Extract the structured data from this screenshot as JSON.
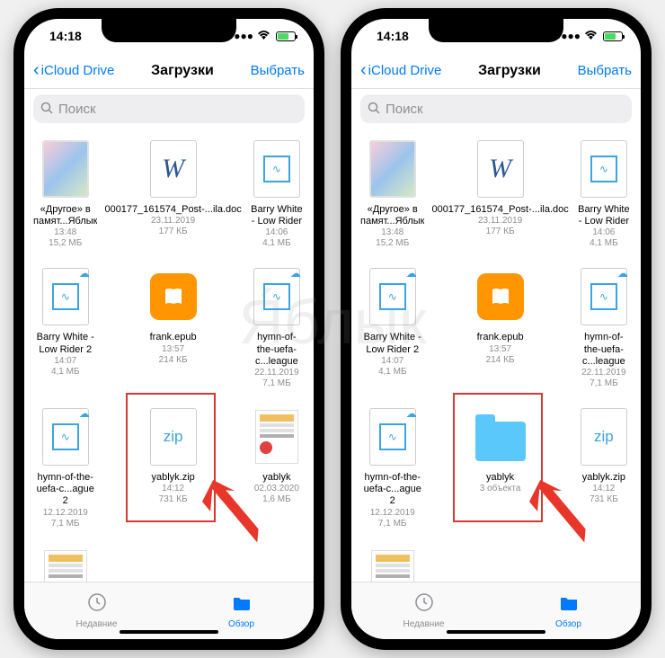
{
  "watermark_text": "Я́блык",
  "phones": {
    "left": {
      "statusbar": {
        "time": "14:18"
      },
      "nav": {
        "back_label": "iCloud Drive",
        "title": "Загрузки",
        "select_label": "Выбрать"
      },
      "search": {
        "placeholder": "Поиск"
      },
      "files": [
        {
          "type": "image",
          "name": "«Другое» в памят...Яблык",
          "line1": "13:48",
          "line2": "15,2 МБ"
        },
        {
          "type": "word",
          "name": "000177_161574_Post-...ila.doc",
          "line1": "23.11.2019",
          "line2": "177 КБ"
        },
        {
          "type": "audio",
          "name": "Barry White - Low Rider",
          "line1": "14:06",
          "line2": "4,1 МБ"
        },
        {
          "type": "audio",
          "cloud": true,
          "name": "Barry White - Low Rider 2",
          "line1": "14:07",
          "line2": "4,1 МБ"
        },
        {
          "type": "book",
          "name": "frank.epub",
          "line1": "13:57",
          "line2": "214 КБ"
        },
        {
          "type": "audio",
          "cloud": true,
          "name": "hymn-of-the-uefa-c...league",
          "line1": "22.11.2019",
          "line2": "7,1 МБ"
        },
        {
          "type": "audio",
          "cloud": true,
          "name": "hymn-of-the-uefa-c...ague 2",
          "line1": "12.12.2019",
          "line2": "7,1 МБ"
        },
        {
          "type": "zip",
          "highlight": true,
          "name": "yablyk.zip",
          "line1": "14:12",
          "line2": "731 КБ"
        },
        {
          "type": "pdf",
          "name": "yablyk",
          "line1": "02.03.2020",
          "line2": "1,6 МБ"
        },
        {
          "type": "pdf",
          "partial": true
        }
      ],
      "tabs": {
        "recent": "Недавние",
        "browse": "Обзор"
      }
    },
    "right": {
      "statusbar": {
        "time": "14:18"
      },
      "nav": {
        "back_label": "iCloud Drive",
        "title": "Загрузки",
        "select_label": "Выбрать"
      },
      "search": {
        "placeholder": "Поиск"
      },
      "files": [
        {
          "type": "image",
          "name": "«Другое» в памят...Яблык",
          "line1": "13:48",
          "line2": "15,2 МБ"
        },
        {
          "type": "word",
          "name": "000177_161574_Post-...ila.doc",
          "line1": "23.11.2019",
          "line2": "177 КБ"
        },
        {
          "type": "audio",
          "name": "Barry White - Low Rider",
          "line1": "14:06",
          "line2": "4,1 МБ"
        },
        {
          "type": "audio",
          "cloud": true,
          "name": "Barry White - Low Rider 2",
          "line1": "14:07",
          "line2": "4,1 МБ"
        },
        {
          "type": "book",
          "name": "frank.epub",
          "line1": "13:57",
          "line2": "214 КБ"
        },
        {
          "type": "audio",
          "cloud": true,
          "name": "hymn-of-the-uefa-c...league",
          "line1": "22.11.2019",
          "line2": "7,1 МБ"
        },
        {
          "type": "audio",
          "cloud": true,
          "name": "hymn-of-the-uefa-c...ague 2",
          "line1": "12.12.2019",
          "line2": "7,1 МБ"
        },
        {
          "type": "folder",
          "highlight": true,
          "name": "yablyk",
          "line1": "3 объекта",
          "line2": ""
        },
        {
          "type": "zip",
          "name": "yablyk.zip",
          "line1": "14:12",
          "line2": "731 КБ"
        },
        {
          "type": "pdf",
          "partial": true
        }
      ],
      "tabs": {
        "recent": "Недавние",
        "browse": "Обзор"
      }
    }
  }
}
